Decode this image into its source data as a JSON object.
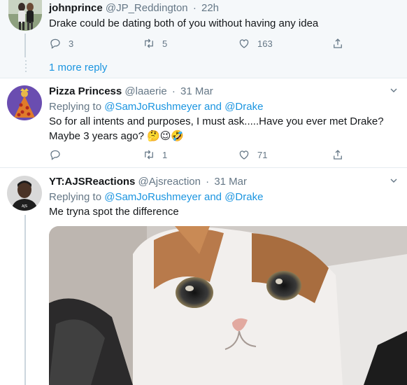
{
  "tweets": [
    {
      "name": "johnprince",
      "handle": "@JP_Reddington",
      "sep": "·",
      "time": "22h",
      "text": "Drake could be dating both of you without having any idea",
      "replies": "3",
      "retweets": "5",
      "likes": "163"
    },
    {
      "name": "Pizza Princess",
      "handle": "@laaerie",
      "sep": "·",
      "time": "31 Mar",
      "replying_prefix": "Replying to",
      "replying_user1": "@SamJoRushmeyer",
      "replying_and": "and",
      "replying_user2": "@Drake",
      "text_line1": "So for all intents and purposes, I must ask.....Have you ever met Drake?",
      "text_line2": "Maybe 3 years ago?",
      "emojis": "🤔😉🤣",
      "retweets": "1",
      "likes": "71"
    },
    {
      "name": "YT:AJSReactions",
      "handle": "@Ajsreaction",
      "sep": "·",
      "time": "31 Mar",
      "replying_prefix": "Replying to",
      "replying_user1": "@SamJoRushmeyer",
      "replying_and": "and",
      "replying_user2": "@Drake",
      "text": "Me tryna spot the difference"
    }
  ],
  "more_replies": "1 more reply",
  "colors": {
    "link": "#1b95e0",
    "muted": "#657786",
    "thread_bg": "#f5f8fa",
    "divider": "#e6ecf0"
  }
}
